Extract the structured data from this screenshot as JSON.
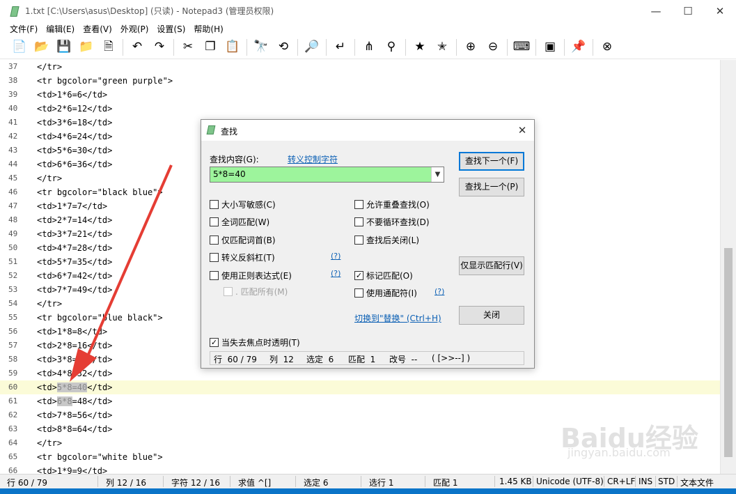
{
  "window": {
    "title": "1.txt [C:\\Users\\asus\\Desktop]  (只读)  - Notepad3  (管理员权限)",
    "controls": {
      "minimize": "—",
      "maximize": "☐",
      "close": "✕"
    }
  },
  "menu": [
    "文件(F)",
    "编辑(E)",
    "查看(V)",
    "外观(P)",
    "设置(S)",
    "帮助(H)"
  ],
  "toolbar": [
    {
      "name": "new-file-icon",
      "glyph": "📄"
    },
    {
      "name": "open-folder-icon",
      "glyph": "📂"
    },
    {
      "name": "save-icon",
      "glyph": "💾"
    },
    {
      "name": "save-as-icon",
      "glyph": "📁"
    },
    {
      "name": "save-copy-icon",
      "glyph": "🗎"
    },
    {
      "sep": true
    },
    {
      "name": "undo-icon",
      "glyph": "↶"
    },
    {
      "name": "redo-icon",
      "glyph": "↷"
    },
    {
      "sep": true
    },
    {
      "name": "cut-icon",
      "glyph": "✂"
    },
    {
      "name": "copy-icon",
      "glyph": "❐"
    },
    {
      "name": "paste-icon",
      "glyph": "📋"
    },
    {
      "sep": true
    },
    {
      "name": "find-icon",
      "glyph": "🔭"
    },
    {
      "name": "replace-icon",
      "glyph": "⟲"
    },
    {
      "sep": true
    },
    {
      "name": "goto-icon",
      "glyph": "🔎"
    },
    {
      "sep": true
    },
    {
      "name": "word-wrap-icon",
      "glyph": "↵"
    },
    {
      "sep": true
    },
    {
      "name": "hierarchy-icon",
      "glyph": "⋔"
    },
    {
      "name": "zoom-find-icon",
      "glyph": "⚲"
    },
    {
      "sep": true
    },
    {
      "name": "favorite-star-icon",
      "glyph": "★"
    },
    {
      "name": "add-favorite-icon",
      "glyph": "✭"
    },
    {
      "sep": true
    },
    {
      "name": "zoom-in-icon",
      "glyph": "⊕"
    },
    {
      "name": "zoom-out-icon",
      "glyph": "⊖"
    },
    {
      "sep": true
    },
    {
      "name": "keyboard-icon",
      "glyph": "⌨"
    },
    {
      "sep": true
    },
    {
      "name": "console-icon",
      "glyph": "▣"
    },
    {
      "sep": true
    },
    {
      "name": "pin-icon",
      "glyph": "📌"
    },
    {
      "sep": true
    },
    {
      "name": "exit-icon",
      "glyph": "⊗"
    }
  ],
  "editor": {
    "current_line": 60,
    "lines": [
      {
        "n": "37",
        "text": "</tr>"
      },
      {
        "n": "38",
        "text": "<tr bgcolor=\"green purple\">"
      },
      {
        "n": "39",
        "text": "<td>1*6=6</td>"
      },
      {
        "n": "40",
        "text": "<td>2*6=12</td>"
      },
      {
        "n": "41",
        "text": "<td>3*6=18</td>"
      },
      {
        "n": "42",
        "text": "<td>4*6=24</td>"
      },
      {
        "n": "43",
        "text": "<td>5*6=30</td>"
      },
      {
        "n": "44",
        "text": "<td>6*6=36</td>"
      },
      {
        "n": "45",
        "text": "</tr>"
      },
      {
        "n": "46",
        "text": "<tr bgcolor=\"black blue\">"
      },
      {
        "n": "47",
        "text": "<td>1*7=7</td>"
      },
      {
        "n": "48",
        "text": "<td>2*7=14</td>"
      },
      {
        "n": "49",
        "text": "<td>3*7=21</td>"
      },
      {
        "n": "50",
        "text": "<td>4*7=28</td>"
      },
      {
        "n": "51",
        "text": "<td>5*7=35</td>"
      },
      {
        "n": "52",
        "text": "<td>6*7=42</td>"
      },
      {
        "n": "53",
        "text": "<td>7*7=49</td>"
      },
      {
        "n": "54",
        "text": "</tr>"
      },
      {
        "n": "55",
        "text": "<tr bgcolor=\"blue black\">"
      },
      {
        "n": "56",
        "text": "<td>1*8=8</td>"
      },
      {
        "n": "57",
        "text": "<td>2*8=16</td>"
      },
      {
        "n": "58",
        "text": "<td>3*8=24</td>"
      },
      {
        "n": "59",
        "text": "<td>4*8=32</td>"
      },
      {
        "n": "60",
        "pre": "<td>",
        "hl": "5*8=40",
        "post": "</td>"
      },
      {
        "n": "61",
        "pre": "<td>",
        "hl": "6*8",
        "post": "=48</td>"
      },
      {
        "n": "62",
        "text": "<td>7*8=56</td>"
      },
      {
        "n": "63",
        "text": "<td>8*8=64</td>"
      },
      {
        "n": "64",
        "text": "</tr>"
      },
      {
        "n": "65",
        "text": "<tr bgcolor=\"white blue\">"
      },
      {
        "n": "66",
        "text": "<td>1*9=9</td>"
      }
    ]
  },
  "find_dialog": {
    "title": "查找",
    "find_label": "查找内容(G):",
    "escape_link": "转义控制字符",
    "find_value": "5*8=40",
    "buttons": {
      "find_next": "查找下一个(F)",
      "find_prev": "查找上一个(P)",
      "show_matching_lines": "仅显示匹配行(V)",
      "close": "关闭"
    },
    "options_left": [
      {
        "label": "大小写敏感(C)",
        "checked": false
      },
      {
        "label": "全词匹配(W)",
        "checked": false
      },
      {
        "label": "仅匹配词首(B)",
        "checked": false
      },
      {
        "label": "转义反斜杠(T)",
        "checked": false
      },
      {
        "label": "使用正则表达式(E)",
        "checked": false
      },
      {
        "label": ". 匹配所有(M)",
        "checked": false,
        "disabled": true
      }
    ],
    "options_right": [
      {
        "label": "允许重叠查找(O)",
        "checked": false
      },
      {
        "label": "不要循环查找(D)",
        "checked": false
      },
      {
        "label": "查找后关闭(L)",
        "checked": false
      },
      {
        "label": "标记匹配(O)",
        "checked": true
      },
      {
        "label": "使用通配符(I)",
        "checked": false
      }
    ],
    "help_mark": "(?)",
    "switch_link": "切换到\"替换\" (Ctrl+H)",
    "transparent_option": {
      "label": "当失去焦点时透明(T)",
      "checked": true
    },
    "status": {
      "line": "行  60 / 79",
      "col": "列  12",
      "sel": "选定  6",
      "match": "匹配  1",
      "mod": "改号  --",
      "nav": "( [>>--] )"
    }
  },
  "statusbar": {
    "line": "行  60 / 79",
    "col": "列  12 / 16",
    "char": "字符  12 / 16",
    "value": "求值  ^[]",
    "sel": "选定  6",
    "selline": "选行  1",
    "match": "匹配  1",
    "size": "1.45 KB",
    "encoding": "Unicode (UTF-8)",
    "eol": "CR+LF",
    "ins": "INS",
    "std": "STD",
    "type": "文本文件"
  },
  "watermark": {
    "main": "Baidu经验",
    "sub": "jingyan.baidu.com"
  },
  "colors": {
    "find_field_bg": "#9df49c",
    "current_line_bg": "#fbfbd8",
    "arrow": "#e53d34",
    "link": "#0a5fb4"
  }
}
